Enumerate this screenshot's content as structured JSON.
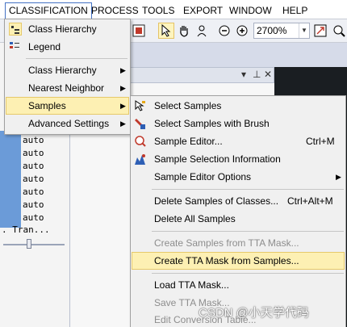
{
  "menubar": {
    "items": [
      "CLASSIFICATION",
      "PROCESS",
      "TOOLS",
      "EXPORT",
      "WINDOW",
      "HELP"
    ]
  },
  "toolbar": {
    "zoom_value": "2700%"
  },
  "workspace": {
    "auto_rows": [
      "auto",
      "auto",
      "auto",
      "auto",
      "auto",
      "auto",
      "auto"
    ],
    "tran_text": ". Tran..."
  },
  "classification_menu": {
    "items": [
      {
        "label": "Class Hierarchy",
        "icon": "class-hierarchy-icon",
        "submenu": false
      },
      {
        "label": "Legend",
        "icon": "legend-icon",
        "submenu": false
      },
      {
        "label": "Class Hierarchy",
        "submenu": true
      },
      {
        "label": "Nearest Neighbor",
        "submenu": true
      },
      {
        "label": "Samples",
        "submenu": true,
        "highlighted": true
      },
      {
        "label": "Advanced Settings",
        "submenu": true
      }
    ]
  },
  "samples_menu": {
    "items": [
      {
        "label": "Select Samples",
        "icon": "select-samples-icon"
      },
      {
        "label": "Select Samples with Brush",
        "icon": "brush-icon"
      },
      {
        "label": "Sample Editor...",
        "icon": "sample-editor-icon",
        "shortcut": "Ctrl+M"
      },
      {
        "label": "Sample Selection Information",
        "icon": "selection-info-icon"
      },
      {
        "label": "Sample Editor Options",
        "submenu": true
      },
      {
        "label": "Delete Samples of Classes...",
        "shortcut": "Ctrl+Alt+M"
      },
      {
        "label": "Delete All Samples"
      },
      {
        "label": "Create Samples from TTA Mask...",
        "disabled": true
      },
      {
        "label": "Create TTA Mask from Samples...",
        "highlighted": true
      },
      {
        "label": "Load TTA Mask..."
      },
      {
        "label": "Save TTA Mask...",
        "disabled": true
      },
      {
        "label": "Edit Conversion Table...",
        "disabled": true
      }
    ]
  },
  "watermark": "CSDN @小天学代码",
  "colors": {
    "highlight": "#fdf0b3",
    "highlight_border": "#e6c96a",
    "menu_bg": "#f0f0f0",
    "disabled_text": "#8d8d8d"
  }
}
